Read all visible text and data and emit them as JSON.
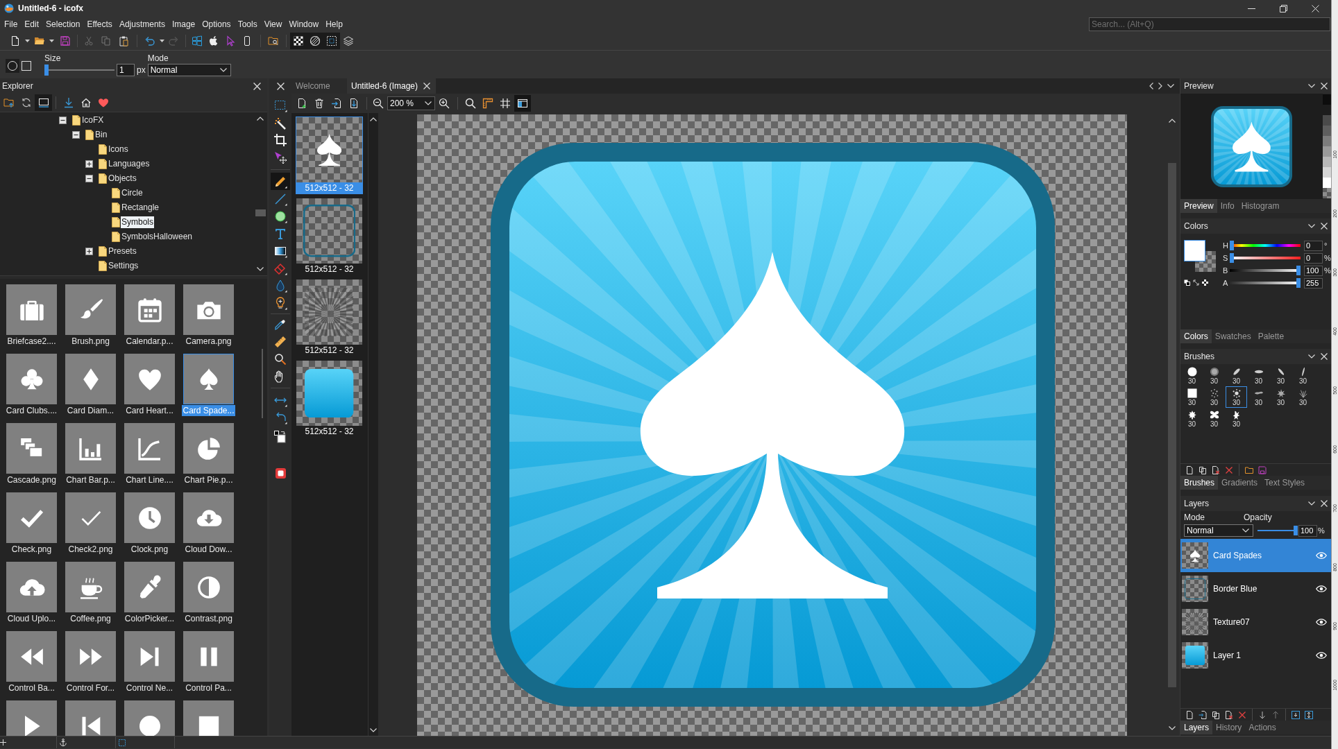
{
  "window": {
    "title": "Untitled-6 - icofx"
  },
  "menu": [
    "File",
    "Edit",
    "Selection",
    "Effects",
    "Adjustments",
    "Image",
    "Options",
    "Tools",
    "View",
    "Window",
    "Help"
  ],
  "search": {
    "placeholder": "Search... (Alt+Q)"
  },
  "toolbar": {
    "view_toggles": [
      {
        "pressed": true
      },
      {
        "pressed": true
      },
      {
        "pressed": true
      },
      {
        "pressed": false
      }
    ]
  },
  "options": {
    "shapes": [
      {
        "selected": true
      },
      {
        "selected": false
      }
    ],
    "size": {
      "label": "Size",
      "level": 0,
      "value": "1",
      "unit": "px"
    },
    "mode": {
      "label": "Mode",
      "value": "Normal"
    }
  },
  "explorer": {
    "title": "Explorer",
    "toolbar": [
      {
        "pressed": false
      },
      {
        "pressed": false
      },
      {
        "pressed": true
      },
      {
        "pressed": false
      },
      {
        "pressed": false
      },
      {
        "pressed": false
      }
    ],
    "tree": [
      {
        "label": "IcoFX",
        "expanded": true,
        "selected": false,
        "children": [
          {
            "label": "Bin",
            "expanded": true,
            "selected": false,
            "children": [
              {
                "label": "Icons",
                "selected": false
              },
              {
                "label": "Languages",
                "expanded": false,
                "selected": false
              },
              {
                "label": "Objects",
                "expanded": true,
                "selected": false,
                "children": [
                  {
                    "label": "Circle",
                    "selected": false
                  },
                  {
                    "label": "Rectangle",
                    "selected": false
                  },
                  {
                    "label": "Symbols",
                    "selected": true
                  },
                  {
                    "label": "SymbolsHalloween",
                    "selected": false
                  }
                ]
              },
              {
                "label": "Presets",
                "expanded": false,
                "selected": false
              },
              {
                "label": "Settings",
                "selected": false
              }
            ]
          }
        ]
      }
    ],
    "files": [
      {
        "label": "Briefcase2....",
        "selected": false
      },
      {
        "label": "Brush.png",
        "selected": false
      },
      {
        "label": "Calendar.p...",
        "selected": false
      },
      {
        "label": "Camera.png",
        "selected": false
      },
      {
        "label": "Card Clubs....",
        "selected": false
      },
      {
        "label": "Card Diam...",
        "selected": false
      },
      {
        "label": "Card Heart...",
        "selected": false
      },
      {
        "label": "Card Spade...",
        "selected": true
      },
      {
        "label": "Cascade.png",
        "selected": false
      },
      {
        "label": "Chart Bar.p...",
        "selected": false
      },
      {
        "label": "Chart Line....",
        "selected": false
      },
      {
        "label": "Chart Pie.p...",
        "selected": false
      },
      {
        "label": "Check.png",
        "selected": false
      },
      {
        "label": "Check2.png",
        "selected": false
      },
      {
        "label": "Clock.png",
        "selected": false
      },
      {
        "label": "Cloud Dow...",
        "selected": false
      },
      {
        "label": "Cloud Uplo...",
        "selected": false
      },
      {
        "label": "Coffee.png",
        "selected": false
      },
      {
        "label": "ColorPicker...",
        "selected": false
      },
      {
        "label": "Contrast.png",
        "selected": false
      },
      {
        "label": "Control Ba...",
        "selected": false
      },
      {
        "label": "Control For...",
        "selected": false
      },
      {
        "label": "Control Ne...",
        "selected": false
      },
      {
        "label": "Control Pa...",
        "selected": false
      },
      {
        "selected": false
      },
      {
        "selected": false
      },
      {
        "selected": false
      },
      {
        "selected": false
      }
    ]
  },
  "tools": [
    {
      "selected": false
    },
    {
      "selected": false
    },
    {
      "selected": false
    },
    {
      "selected": false
    },
    {
      "selected": true
    },
    {
      "selected": false
    },
    {
      "selected": false
    },
    {
      "selected": false
    },
    {
      "selected": false
    },
    {
      "selected": false
    },
    {
      "selected": false
    },
    {
      "selected": false
    },
    {
      "selected": false
    },
    {
      "selected": false
    },
    {
      "selected": false
    },
    {
      "selected": false
    },
    {
      "selected": false
    },
    {
      "selected": false
    }
  ],
  "document_tabs": [
    {
      "label": "Welcome",
      "selected": false
    },
    {
      "label": "Untitled-6 (Image)",
      "selected": true
    }
  ],
  "canvas_toolbar": {
    "zoom": "200 %",
    "toggles": [
      {
        "pressed": false
      },
      {
        "pressed": false
      },
      {
        "pressed": false
      },
      {
        "pressed": true
      }
    ]
  },
  "images": [
    {
      "label": "512x512 - 32",
      "selected": true
    },
    {
      "label": "512x512 - 32",
      "selected": false
    },
    {
      "label": "512x512 - 32",
      "selected": false
    },
    {
      "label": "512x512 - 32",
      "selected": false
    }
  ],
  "preview": {
    "title": "Preview",
    "backgrounds": [
      {
        "kind": "solid",
        "color": "#0d0d0d"
      },
      {
        "kind": "solid",
        "color": "#1d1d1d"
      },
      {
        "kind": "solid",
        "color": "#4a4a4a"
      },
      {
        "kind": "solid",
        "color": "#5e5e5e"
      },
      {
        "kind": "solid",
        "color": "#7c7c7c"
      },
      {
        "kind": "solid",
        "color": "#9a9a9a"
      },
      {
        "kind": "solid",
        "color": "#b8b8b8"
      },
      {
        "kind": "solid",
        "color": "#d6d6d6"
      },
      {
        "kind": "solid",
        "color": "#ffffff"
      },
      {
        "kind": "checker"
      }
    ],
    "tabs": [
      {
        "label": "Preview",
        "selected": true
      },
      {
        "label": "Info",
        "selected": false
      },
      {
        "label": "Histogram",
        "selected": false
      }
    ]
  },
  "colors": {
    "title": "Colors",
    "foreground": {
      "color": "#ffffff"
    },
    "channels": [
      {
        "label": "H",
        "value": "0",
        "unit": "°",
        "level": 0
      },
      {
        "label": "S",
        "value": "0",
        "unit": "%",
        "level": 0
      },
      {
        "label": "B",
        "value": "100",
        "unit": "%",
        "level": 1
      },
      {
        "label": "A",
        "value": "255",
        "level": 1
      }
    ],
    "tabs": [
      {
        "label": "Colors",
        "selected": true
      },
      {
        "label": "Swatches",
        "selected": false
      },
      {
        "label": "Palette",
        "selected": false
      }
    ]
  },
  "brushes": {
    "title": "Brushes",
    "items": [
      {
        "size": "30",
        "selected": false
      },
      {
        "size": "30",
        "selected": false
      },
      {
        "size": "30",
        "selected": false
      },
      {
        "size": "30",
        "selected": false
      },
      {
        "size": "30",
        "selected": false
      },
      {
        "size": "30",
        "selected": false
      },
      {
        "size": "30",
        "selected": false
      },
      {
        "size": "30",
        "selected": false
      },
      {
        "size": "30",
        "selected": true
      },
      {
        "size": "30",
        "selected": false
      },
      {
        "size": "30",
        "selected": false
      },
      {
        "size": "30",
        "selected": false
      },
      {
        "size": "30",
        "selected": false
      },
      {
        "size": "30",
        "selected": false
      },
      {
        "size": "30",
        "selected": false
      }
    ],
    "tabs": [
      {
        "label": "Brushes",
        "selected": true
      },
      {
        "label": "Gradients",
        "selected": false
      },
      {
        "label": "Text Styles",
        "selected": false
      }
    ]
  },
  "layers": {
    "title": "Layers",
    "mode": {
      "label": "Mode",
      "value": "Normal"
    },
    "opacity": {
      "label": "Opacity",
      "level": 1,
      "value": "100",
      "unit": "%"
    },
    "items": [
      {
        "name": "Card Spades",
        "selected": true,
        "visible": true
      },
      {
        "name": "Border Blue",
        "selected": false,
        "visible": true
      },
      {
        "name": "Texture07",
        "selected": false,
        "visible": true
      },
      {
        "name": "Layer 1",
        "selected": false,
        "visible": true
      }
    ],
    "tabs": [
      {
        "label": "Layers",
        "selected": true
      },
      {
        "label": "History",
        "selected": false
      },
      {
        "label": "Actions",
        "selected": false
      }
    ]
  },
  "background_window": {
    "ruler_labels": [
      "100",
      "200",
      "300",
      "400",
      "500",
      "600",
      "700",
      "800",
      "900",
      "1000"
    ]
  }
}
